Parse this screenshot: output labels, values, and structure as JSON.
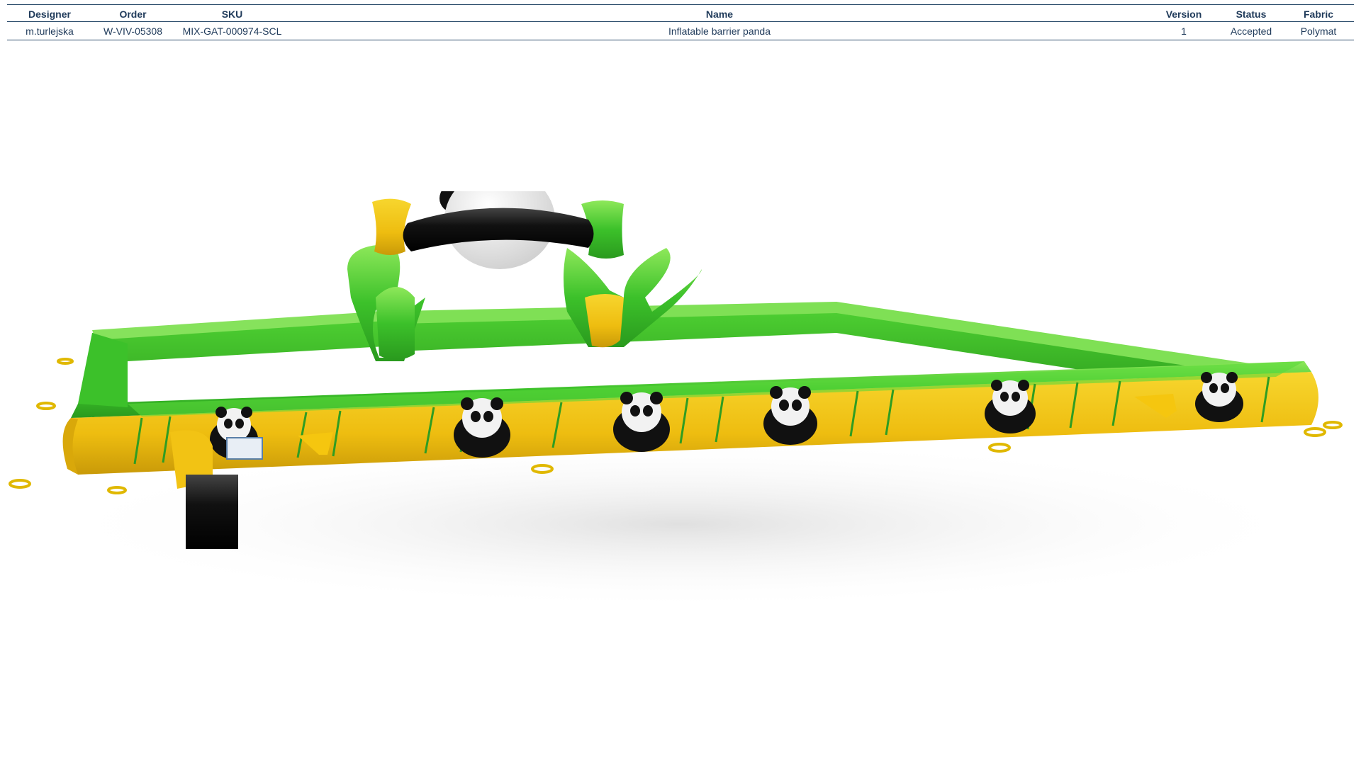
{
  "header": {
    "columns": [
      "Designer",
      "Order",
      "SKU",
      "Name",
      "Version",
      "Status",
      "Fabric"
    ],
    "row": {
      "designer": "m.turlejska",
      "order": "W-VIV-05308",
      "sku": "MIX-GAT-000974-SCL",
      "name": "Inflatable barrier panda",
      "version": "1",
      "status": "Accepted",
      "fabric": "Polymat"
    }
  },
  "render": {
    "subject": "inflatable-panda-barrier",
    "colors": {
      "green": "#3cc12a",
      "yellow": "#f2c314",
      "black": "#111111",
      "white": "#f4f4f4"
    }
  }
}
